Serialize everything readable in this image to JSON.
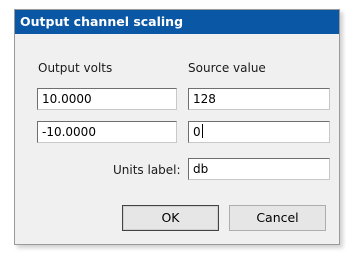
{
  "dialog": {
    "title": "Output channel scaling",
    "headers": {
      "output_volts": "Output volts",
      "source_value": "Source value"
    },
    "rows": [
      {
        "output_volts": "10.0000",
        "source_value": "128"
      },
      {
        "output_volts": "-10.0000",
        "source_value": "0"
      }
    ],
    "units_label": {
      "label": "Units label:",
      "value": "db"
    },
    "buttons": {
      "ok": "OK",
      "cancel": "Cancel"
    }
  }
}
